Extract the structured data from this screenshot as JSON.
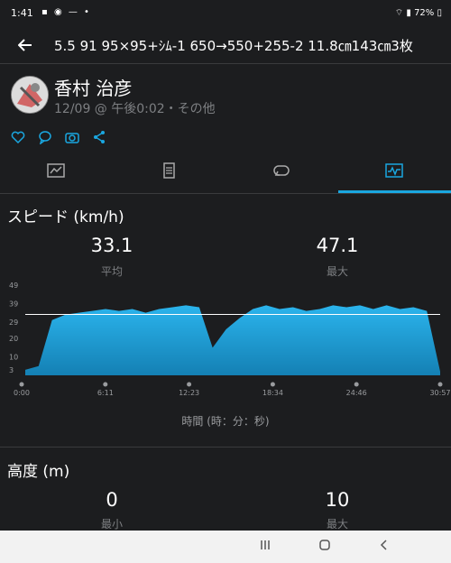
{
  "status_bar": {
    "time": "1:41",
    "battery": "72%"
  },
  "header": {
    "title": "5.5 91 95×95+ｼﾑ-1 650→550+255-2 11.8㎝143㎝3枚"
  },
  "profile": {
    "name": "香村 治彦",
    "date": "12/09 @ 午後0:02・その他"
  },
  "speed": {
    "title": "スピード (km/h)",
    "avg_value": "33.1",
    "avg_label": "平均",
    "max_value": "47.1",
    "max_label": "最大"
  },
  "chart_data": {
    "type": "area",
    "yticks": [
      "3",
      "10",
      "20",
      "29",
      "39",
      "49"
    ],
    "xticks": [
      "0:00",
      "6:11",
      "12:23",
      "18:34",
      "24:46",
      "30:57"
    ],
    "xlabel": "時間 (時：分：秒)",
    "avg_line": 33.1,
    "ylim": [
      0,
      49
    ],
    "x_minutes": [
      0,
      1,
      2,
      3,
      4,
      5,
      6,
      7,
      8,
      9,
      10,
      11,
      12,
      13,
      14,
      15,
      16,
      17,
      18,
      19,
      20,
      21,
      22,
      23,
      24,
      25,
      26,
      27,
      28,
      29,
      30,
      31
    ],
    "values": [
      3,
      5,
      30,
      33,
      34,
      35,
      36,
      35,
      36,
      34,
      36,
      37,
      38,
      37,
      15,
      25,
      31,
      36,
      38,
      36,
      37,
      35,
      36,
      38,
      37,
      38,
      36,
      38,
      36,
      37,
      35,
      2
    ]
  },
  "altitude": {
    "title": "高度 (m)",
    "min_value": "0",
    "min_label": "最小",
    "max_value": "10",
    "max_label": "最大"
  },
  "colors": {
    "accent": "#1aa7e0",
    "background": "#1c1d1f",
    "chart_fill": "#1a9fd8"
  }
}
